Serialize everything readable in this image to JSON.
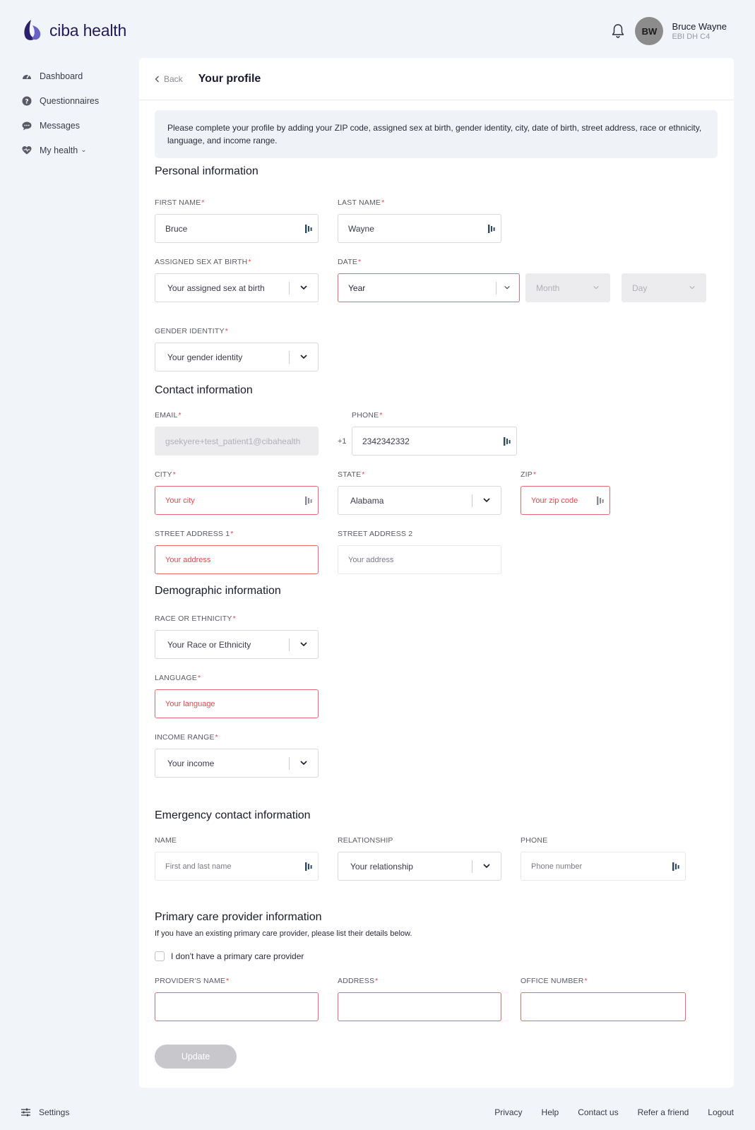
{
  "brand": {
    "name": "ciba health",
    "logo_color": "#231a5c"
  },
  "user": {
    "initials": "BW",
    "name": "Bruce Wayne",
    "subtitle": "EBI DH C4"
  },
  "sidebar": {
    "items": [
      {
        "label": "Dashboard",
        "icon": "gauge-icon"
      },
      {
        "label": "Questionnaires",
        "icon": "question-icon"
      },
      {
        "label": "Messages",
        "icon": "chat-icon"
      },
      {
        "label": "My health",
        "icon": "heart-icon"
      }
    ]
  },
  "header": {
    "back_label": "Back",
    "title": "Your profile"
  },
  "notice": "Please complete your profile by adding your ZIP code, assigned sex at birth, gender identity, city, date of birth, street address, race or ethnicity, language, and income range.",
  "personal": {
    "title": "Personal information",
    "first_name_label": "FIRST NAME",
    "first_name_value": "Bruce",
    "last_name_label": "LAST NAME",
    "last_name_value": "Wayne",
    "sex_label": "ASSIGNED SEX AT BIRTH",
    "sex_placeholder": "Your assigned sex at birth",
    "date_label": "DATE",
    "year_placeholder": "Year",
    "month_placeholder": "Month",
    "day_placeholder": "Day",
    "gender_label": "GENDER IDENTITY",
    "gender_placeholder": "Your gender identity"
  },
  "contact": {
    "title": "Contact information",
    "email_label": "EMAIL",
    "email_value": "gsekyere+test_patient1@cibahealth",
    "phone_label": "PHONE",
    "phone_prefix": "+1",
    "phone_value": "2342342332",
    "city_label": "CITY",
    "city_placeholder": "Your city",
    "state_label": "STATE",
    "state_value": "Alabama",
    "zip_label": "ZIP",
    "zip_placeholder": "Your zip code",
    "street1_label": "STREET ADDRESS 1",
    "street1_placeholder": "Your address",
    "street2_label": "STREET ADDRESS 2",
    "street2_placeholder": "Your address"
  },
  "demographic": {
    "title": "Demographic information",
    "race_label": "RACE OR ETHNICITY",
    "race_placeholder": "Your Race or Ethnicity",
    "language_label": "LANGUAGE",
    "language_placeholder": "Your language",
    "income_label": "INCOME RANGE",
    "income_placeholder": "Your income"
  },
  "emergency": {
    "title": "Emergency contact information",
    "name_label": "NAME",
    "name_placeholder": "First and last name",
    "relationship_label": "RELATIONSHIP",
    "relationship_placeholder": "Your relationship",
    "phone_label": "PHONE",
    "phone_placeholder": "Phone number"
  },
  "pcp": {
    "title": "Primary care provider information",
    "note": "If you have an existing primary care provider, please list their details below.",
    "checkbox_label": "I don't have a primary care provider",
    "provider_label": "PROVIDER'S NAME",
    "address_label": "ADDRESS",
    "office_label": "OFFICE NUMBER"
  },
  "actions": {
    "update_label": "Update"
  },
  "footer": {
    "settings_label": "Settings",
    "links": [
      "Privacy",
      "Help",
      "Contact us",
      "Refer a friend",
      "Logout"
    ]
  },
  "colors": {
    "error": "#e5484d",
    "accent": "#231a5c",
    "background": "#f1f4f8"
  }
}
